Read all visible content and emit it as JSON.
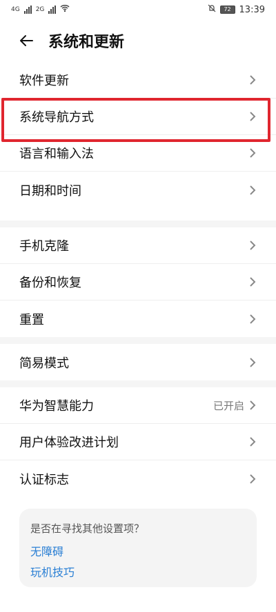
{
  "status": {
    "network_labels": [
      "4G",
      "2G"
    ],
    "time": "13:39",
    "battery": "72"
  },
  "header": {
    "title": "系统和更新"
  },
  "sections": [
    {
      "items": [
        {
          "label": "软件更新",
          "value": ""
        },
        {
          "label": "系统导航方式",
          "value": ""
        },
        {
          "label": "语言和输入法",
          "value": ""
        },
        {
          "label": "日期和时间",
          "value": ""
        }
      ]
    },
    {
      "items": [
        {
          "label": "手机克隆",
          "value": ""
        },
        {
          "label": "备份和恢复",
          "value": ""
        },
        {
          "label": "重置",
          "value": ""
        }
      ]
    },
    {
      "items": [
        {
          "label": "简易模式",
          "value": ""
        }
      ]
    },
    {
      "items": [
        {
          "label": "华为智慧能力",
          "value": "已开启"
        },
        {
          "label": "用户体验改进计划",
          "value": ""
        },
        {
          "label": "认证标志",
          "value": ""
        }
      ]
    }
  ],
  "card": {
    "question": "是否在寻找其他设置项？",
    "links": [
      "无障碍",
      "玩机技巧"
    ]
  },
  "colors": {
    "highlight": "#e0262f",
    "link": "#2a7fd4"
  }
}
